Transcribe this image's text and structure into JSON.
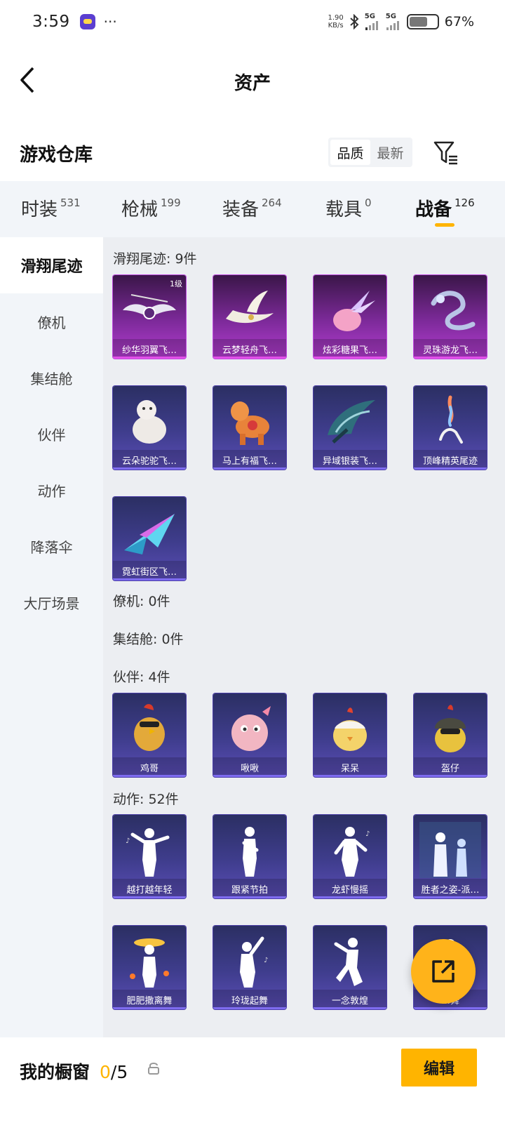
{
  "status_bar": {
    "time": "3:59",
    "dots": "···",
    "speed_value": "1.90",
    "speed_unit": "KB/s",
    "network_1": "5G",
    "network_2": "5G",
    "battery_level": 0.67,
    "battery_text": "67%"
  },
  "header": {
    "title": "资产"
  },
  "warehouse": {
    "title": "游戏仓库",
    "sort_quality": "品质",
    "sort_newest": "最新"
  },
  "tabs": [
    {
      "label": "时装",
      "count": "531"
    },
    {
      "label": "枪械",
      "count": "199"
    },
    {
      "label": "装备",
      "count": "264"
    },
    {
      "label": "载具",
      "count": "0"
    },
    {
      "label": "战备",
      "count": "126"
    }
  ],
  "sidebar": {
    "items": [
      "滑翔尾迹",
      "僚机",
      "集结舱",
      "伙伴",
      "动作",
      "降落伞",
      "大厅场景"
    ]
  },
  "sections": {
    "glide": {
      "title": "滑翔尾迹: 9件",
      "items": [
        {
          "name": "纱华羽翼飞…",
          "level": "1级"
        },
        {
          "name": "云梦轻舟飞…"
        },
        {
          "name": "炫彩糖果飞…"
        },
        {
          "name": "灵珠游龙飞…"
        },
        {
          "name": "云朵驼驼飞…"
        },
        {
          "name": "马上有福飞…"
        },
        {
          "name": "异域银装飞…"
        },
        {
          "name": "顶峰精英尾迹"
        },
        {
          "name": "霓虹街区飞…"
        }
      ]
    },
    "wingman": {
      "title": "僚机: 0件"
    },
    "rally_pod": {
      "title": "集结舱: 0件"
    },
    "partner": {
      "title": "伙伴: 4件",
      "items": [
        "鸡哥",
        "啾啾",
        "呆呆",
        "盔仔"
      ]
    },
    "action": {
      "title": "动作: 52件",
      "items": [
        "越打越年轻",
        "跟紧节拍",
        "龙虾慢摇",
        "胜者之姿-派…",
        "肥肥撒离舞",
        "玲珑起舞",
        "一念敦煌",
        "…舞"
      ]
    }
  },
  "bottom": {
    "my_showcase": "我的橱窗",
    "showcase_current": "0",
    "showcase_total": "/5",
    "edit": "编辑"
  },
  "colors": {
    "accent": "#ffb400",
    "card_purple": "#3f3d8d",
    "card_pink": "#b23dd0"
  }
}
